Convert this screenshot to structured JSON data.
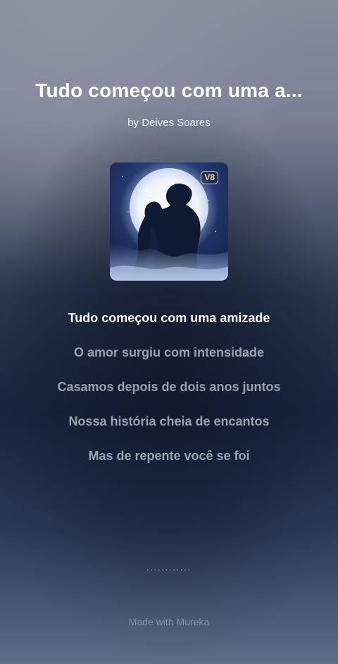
{
  "song": {
    "title": "Tudo começou com uma a...",
    "artist": "by Deives Soares",
    "version_badge": "V8",
    "cover_icon": "couple-moon-artwork"
  },
  "lyrics": [
    {
      "text": "Tudo começou com uma amizade",
      "current": true
    },
    {
      "text": "O amor surgiu com intensidade",
      "current": false
    },
    {
      "text": "Casamos depois de dois anos juntos",
      "current": false
    },
    {
      "text": "Nossa história cheia de encantos",
      "current": false
    },
    {
      "text": "Mas de repente você se foi",
      "current": false
    }
  ],
  "progress_dots": "............",
  "footer": "Made with Mureka",
  "colors": {
    "current_lyric": "#ffffff",
    "inactive_lyric": "#cdd4e4",
    "badge": "#e3c560"
  }
}
